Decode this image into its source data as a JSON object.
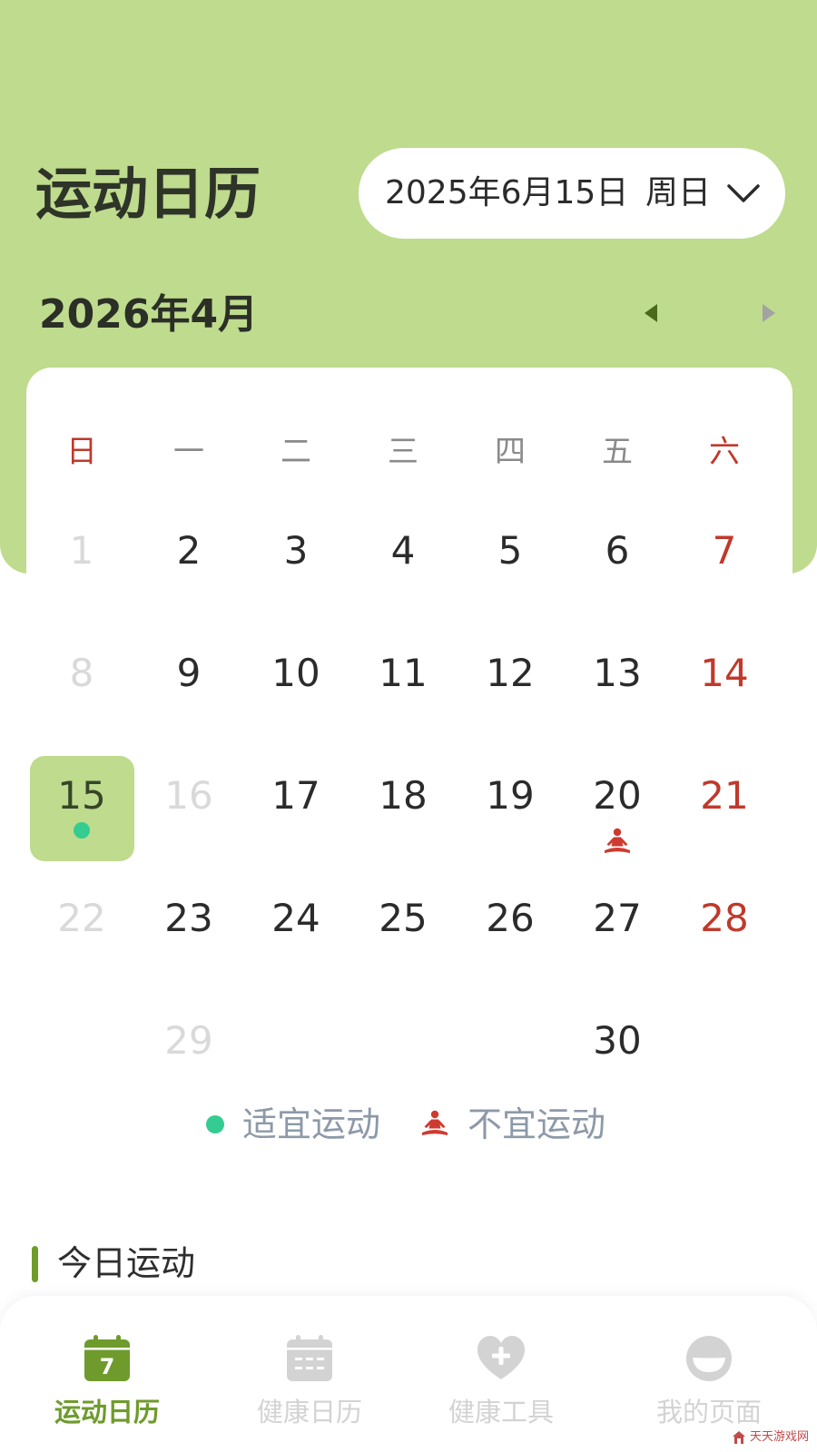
{
  "header": {
    "title": "运动日历",
    "date_picker": {
      "date": "2025年6月15日",
      "weekday": "周日",
      "icon": "chevron-down-icon"
    },
    "month_label": "2026年4月",
    "prev_icon": "triangle-left-icon",
    "next_icon": "triangle-right-icon"
  },
  "calendar": {
    "weekdays": [
      {
        "label": "日",
        "weekend": true
      },
      {
        "label": "一"
      },
      {
        "label": "二"
      },
      {
        "label": "三"
      },
      {
        "label": "四"
      },
      {
        "label": "五"
      },
      {
        "label": "六",
        "weekend": true
      }
    ],
    "rows": [
      [
        {
          "day": 1,
          "muted": true
        },
        {
          "day": 2
        },
        {
          "day": 3
        },
        {
          "day": 4
        },
        {
          "day": 5
        },
        {
          "day": 6
        },
        {
          "day": 7,
          "weekend": true
        }
      ],
      [
        {
          "day": 8,
          "muted": true
        },
        {
          "day": 9
        },
        {
          "day": 10
        },
        {
          "day": 11
        },
        {
          "day": 12
        },
        {
          "day": 13
        },
        {
          "day": 14,
          "weekend": true
        }
      ],
      [
        {
          "day": 15,
          "selected": true,
          "suitable": true
        },
        {
          "day": 16,
          "muted": true
        },
        {
          "day": 17
        },
        {
          "day": 18
        },
        {
          "day": 19
        },
        {
          "day": 20,
          "unsuitable": true
        },
        {
          "day": 21,
          "weekend": true
        }
      ],
      [
        {
          "day": 22,
          "muted": true
        },
        {
          "day": 23
        },
        {
          "day": 24
        },
        {
          "day": 25
        },
        {
          "day": 26
        },
        {
          "day": 27
        },
        {
          "day": 28,
          "weekend": true
        }
      ],
      [
        null,
        {
          "day": 29,
          "muted": true
        },
        null,
        null,
        null,
        {
          "day": 30
        },
        null
      ]
    ]
  },
  "legend": {
    "suitable_icon": "green-dot-icon",
    "suitable_label": "适宜运动",
    "unsuitable_icon": "meditation-icon",
    "unsuitable_label": "不宜运动"
  },
  "section": {
    "title": "今日运动"
  },
  "nav": [
    {
      "label": "运动日历",
      "icon": "calendar-icon",
      "icon_text": "7",
      "active": true
    },
    {
      "label": "健康日历",
      "icon": "calendar-grid-icon",
      "active": false
    },
    {
      "label": "健康工具",
      "icon": "heart-plus-icon",
      "active": false
    },
    {
      "label": "我的页面",
      "icon": "profile-face-icon",
      "active": false
    }
  ],
  "watermark": "天天游戏网",
  "colors": {
    "header_background": "#bedb8e",
    "active_green": "#6e9b2c",
    "weekend_red": "#c0392b",
    "unsuitable_red": "#cf3a30",
    "suitable_green": "#34cc91",
    "muted_day": "#d9d9d9",
    "legend_text": "#8d99a8",
    "inactive_nav": "#d3d3d3",
    "prev_arrow": "#4a6a1a",
    "next_arrow": "#a3a3a3"
  }
}
